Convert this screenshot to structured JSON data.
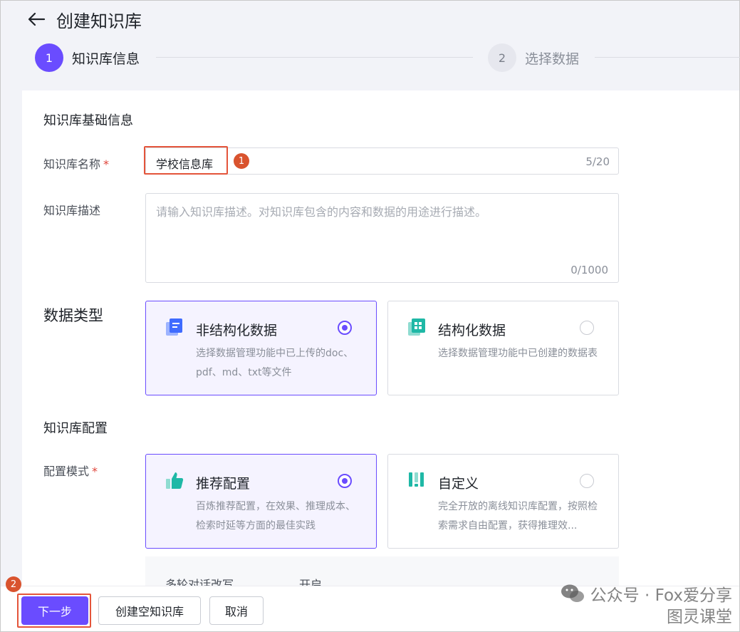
{
  "header": {
    "title": "创建知识库"
  },
  "steps": [
    {
      "number": "1",
      "label": "知识库信息",
      "active": true
    },
    {
      "number": "2",
      "label": "选择数据",
      "active": false
    }
  ],
  "basic": {
    "section_title": "知识库基础信息",
    "name_label": "知识库名称",
    "required_mark": "*",
    "name_value": "学校信息库",
    "name_count": "5/20",
    "desc_label": "知识库描述",
    "desc_placeholder": "请输入知识库描述。对知识库包含的内容和数据的用途进行描述。",
    "desc_count": "0/1000"
  },
  "data_type": {
    "label": "数据类型",
    "options": [
      {
        "title": "非结构化数据",
        "desc": "选择数据管理功能中已上传的doc、pdf、md、txt等文件",
        "selected": true
      },
      {
        "title": "结构化数据",
        "desc": "选择数据管理功能中已创建的数据表",
        "selected": false
      }
    ]
  },
  "config": {
    "section_title": "知识库配置",
    "mode_label": "配置模式",
    "options": [
      {
        "title": "推荐配置",
        "desc": "百炼推荐配置，在效果、推理成本、检索时延等方面的最佳实践",
        "selected": true
      },
      {
        "title": "自定义",
        "desc": "完全开放的离线知识库配置，按照检索需求自由配置，获得推理效...",
        "selected": false
      }
    ],
    "sub_label": "多轮对话改写",
    "sub_value": "开启"
  },
  "annotations": {
    "badge1": "1",
    "badge2": "2"
  },
  "footer": {
    "next_label": "下一步",
    "create_empty_label": "创建空知识库",
    "cancel_label": "取消"
  },
  "watermark": {
    "line1": "公众号 · Fox爱分享",
    "line2": "图灵课堂"
  },
  "colors": {
    "accent": "#6a4cff",
    "highlight": "#e4543a",
    "icon_teal": "#1fb8a6",
    "icon_blue": "#3f6bff"
  }
}
